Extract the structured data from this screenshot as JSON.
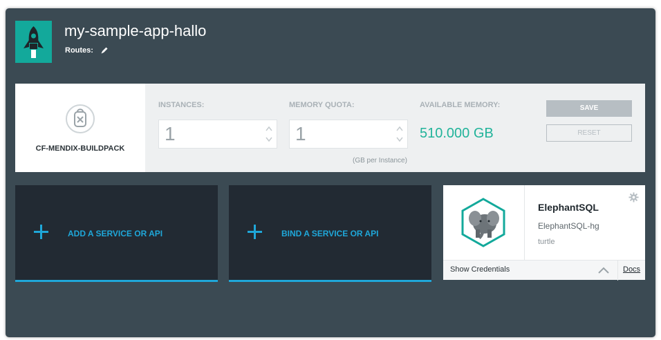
{
  "app": {
    "title": "my-sample-app-hallo",
    "routes_label": "Routes:",
    "icon": "rocket-icon"
  },
  "buildpack": {
    "name": "CF-MENDIX-BUILDPACK",
    "icon": "backpack-icon"
  },
  "instances": {
    "label": "INSTANCES:",
    "value": "1"
  },
  "memory": {
    "label": "MEMORY QUOTA:",
    "value": "1",
    "hint": "(GB per Instance)"
  },
  "available": {
    "label": "AVAILABLE MEMORY:",
    "value": "510.000 GB"
  },
  "actions": {
    "save": "SAVE",
    "reset": "RESET"
  },
  "services": {
    "add_label": "ADD A SERVICE OR API",
    "bind_label": "BIND A SERVICE OR API"
  },
  "service_card": {
    "name": "ElephantSQL",
    "instance": "ElephantSQL-hg",
    "plan": "turtle",
    "show_credentials": "Show Credentials",
    "docs": "Docs",
    "logo": "elephant-logo"
  },
  "colors": {
    "frame": "#3b4a53",
    "accent_teal": "#13a99b",
    "accent_blue": "#1fa7d9",
    "memory_green": "#21b39a",
    "tile_dark": "#222a33"
  }
}
